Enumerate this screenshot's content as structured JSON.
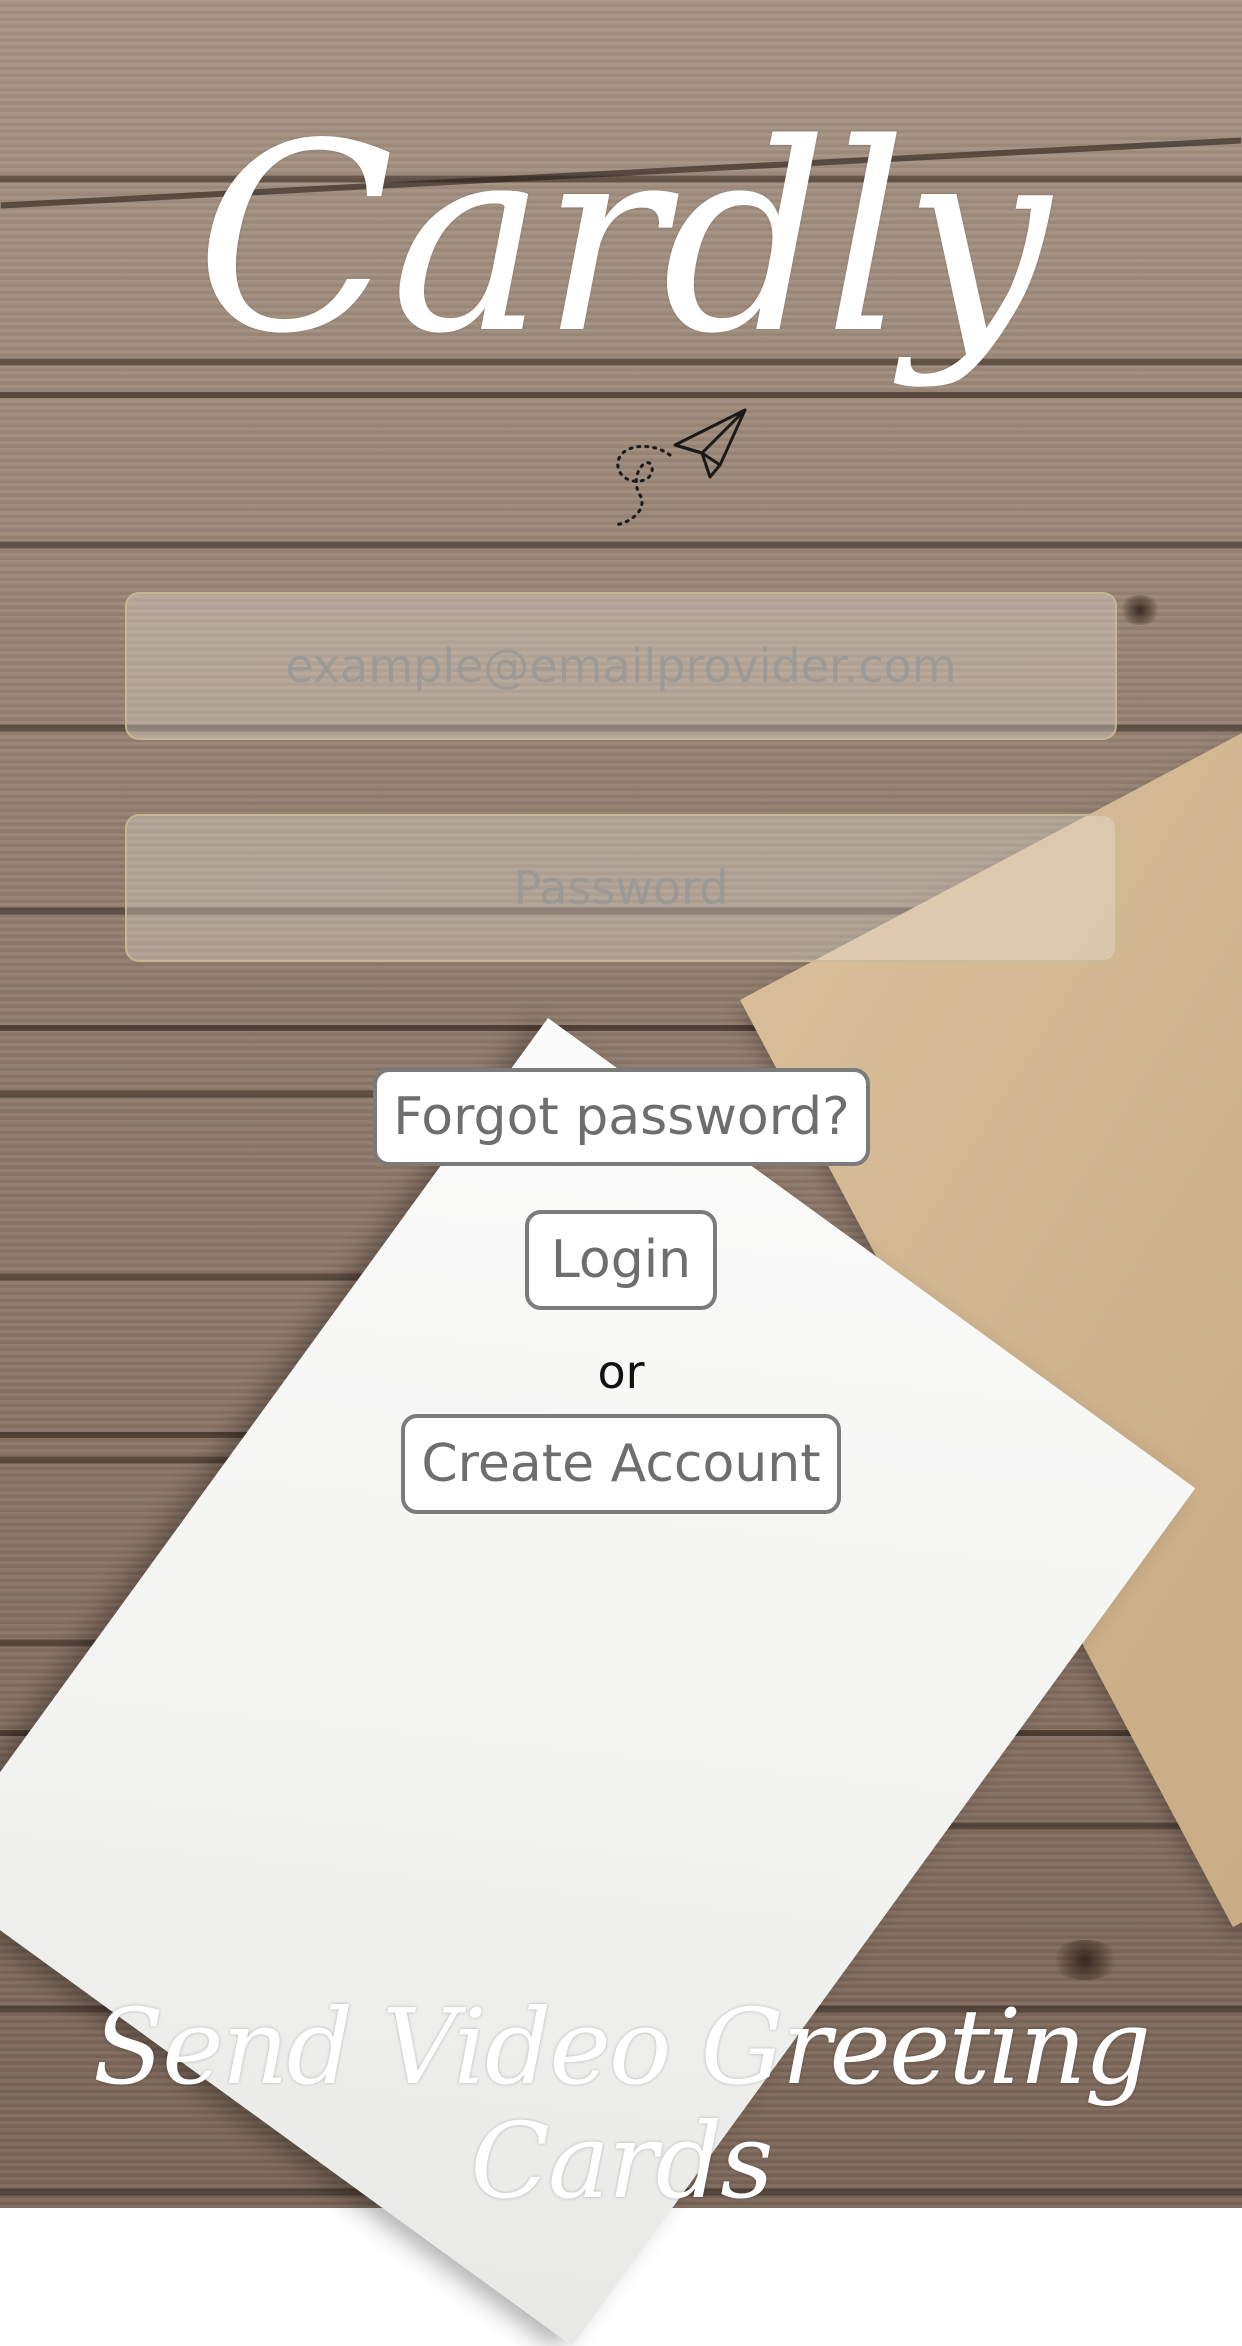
{
  "app": {
    "logo_text": "Cardly",
    "tagline": "Send Video Greeting Cards"
  },
  "icons": {
    "logo_decoration": "paper-plane-icon"
  },
  "login_form": {
    "email_placeholder": "example@emailprovider.com",
    "email_value": "",
    "password_placeholder": "Password",
    "password_value": "",
    "forgot_label": "Forgot password?",
    "login_label": "Login",
    "separator": "or",
    "create_account_label": "Create Account"
  }
}
